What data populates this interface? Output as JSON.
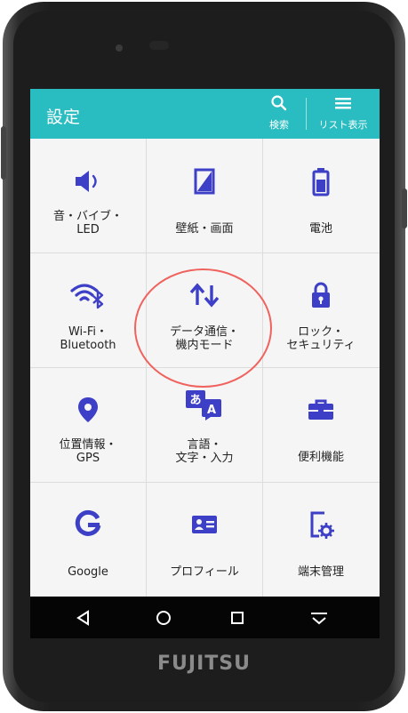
{
  "header": {
    "title": "設定",
    "search_label": "検索",
    "list_label": "リスト表示"
  },
  "brand": "FUJITSU",
  "items": [
    {
      "label": "音・バイブ・\nLED",
      "icon": "volume-icon"
    },
    {
      "label": "壁紙・画面",
      "icon": "wallpaper-icon"
    },
    {
      "label": "電池",
      "icon": "battery-icon"
    },
    {
      "label": "Wi-Fi・\nBluetooth",
      "icon": "wifi-bluetooth-icon"
    },
    {
      "label": "データ通信・\n機内モード",
      "icon": "data-transfer-icon"
    },
    {
      "label": "ロック・\nセキュリティ",
      "icon": "lock-icon"
    },
    {
      "label": "位置情報・\nGPS",
      "icon": "location-icon"
    },
    {
      "label": "言語・\n文字・入力",
      "icon": "language-icon"
    },
    {
      "label": "便利機能",
      "icon": "toolbox-icon"
    },
    {
      "label": "Google",
      "icon": "google-icon"
    },
    {
      "label": "プロフィール",
      "icon": "profile-icon"
    },
    {
      "label": "端末管理",
      "icon": "device-admin-icon"
    }
  ],
  "navigation": [
    "back-icon",
    "home-icon",
    "recents-icon",
    "dropdown-icon"
  ],
  "colors": {
    "accent": "#29bcc0",
    "icon": "#3d3fc6",
    "highlight": "#f0625e"
  }
}
